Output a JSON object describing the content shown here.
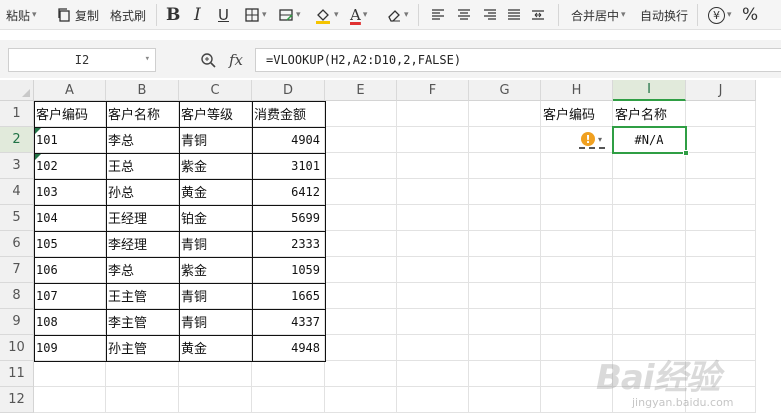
{
  "toolbar": {
    "paste_label": "粘贴",
    "copy_label": "复制",
    "format_painter_label": "格式刷",
    "bold_label": "B",
    "italic_label": "I",
    "underline_label": "U",
    "font_color_label": "A",
    "merge_center_label": "合并居中",
    "wrap_text_label": "自动换行",
    "currency_label": "¥",
    "percent_label": "%"
  },
  "formula_bar": {
    "name_box": "I2",
    "fx_label": "fx",
    "formula": "=VLOOKUP(H2,A2:D10,2,FALSE)"
  },
  "columns": [
    "A",
    "B",
    "C",
    "D",
    "E",
    "F",
    "G",
    "H",
    "I",
    "J"
  ],
  "rows": [
    "1",
    "2",
    "3",
    "4",
    "5",
    "6",
    "7",
    "8",
    "9",
    "10",
    "11",
    "12"
  ],
  "selected": {
    "column": "I",
    "row": "2"
  },
  "table": {
    "headers": [
      "客户编码",
      "客户名称",
      "客户等级",
      "消费金额"
    ],
    "data": [
      [
        "101",
        "李总",
        "青铜",
        "4904"
      ],
      [
        "102",
        "王总",
        "紫金",
        "3101"
      ],
      [
        "103",
        "孙总",
        "黄金",
        "6412"
      ],
      [
        "104",
        "王经理",
        "铂金",
        "5699"
      ],
      [
        "105",
        "李经理",
        "青铜",
        "2333"
      ],
      [
        "106",
        "李总",
        "紫金",
        "1059"
      ],
      [
        "107",
        "王主管",
        "青铜",
        "1665"
      ],
      [
        "108",
        "李主管",
        "青铜",
        "4337"
      ],
      [
        "109",
        "孙主管",
        "黄金",
        "4948"
      ]
    ]
  },
  "lookup": {
    "h1": "客户编码",
    "i1": "客户名称",
    "h2": "",
    "i2": "#N/A"
  },
  "warning_icon": "!",
  "watermark": {
    "logo": "Bai经验",
    "sub": "jingyan.baidu.com"
  },
  "colors": {
    "selection": "#2f9e44",
    "warning": "#f0a020",
    "header_bg": "#f1f1f1"
  },
  "icons": [
    "paste-icon",
    "copy-icon",
    "format-painter-icon",
    "border-icon",
    "fill-color-icon",
    "eraser-icon",
    "align-left-icon",
    "align-center-icon",
    "align-right-icon",
    "justify-icon",
    "distribute-icon",
    "currency-icon",
    "percent-icon",
    "zoom-icon",
    "warning-icon"
  ]
}
